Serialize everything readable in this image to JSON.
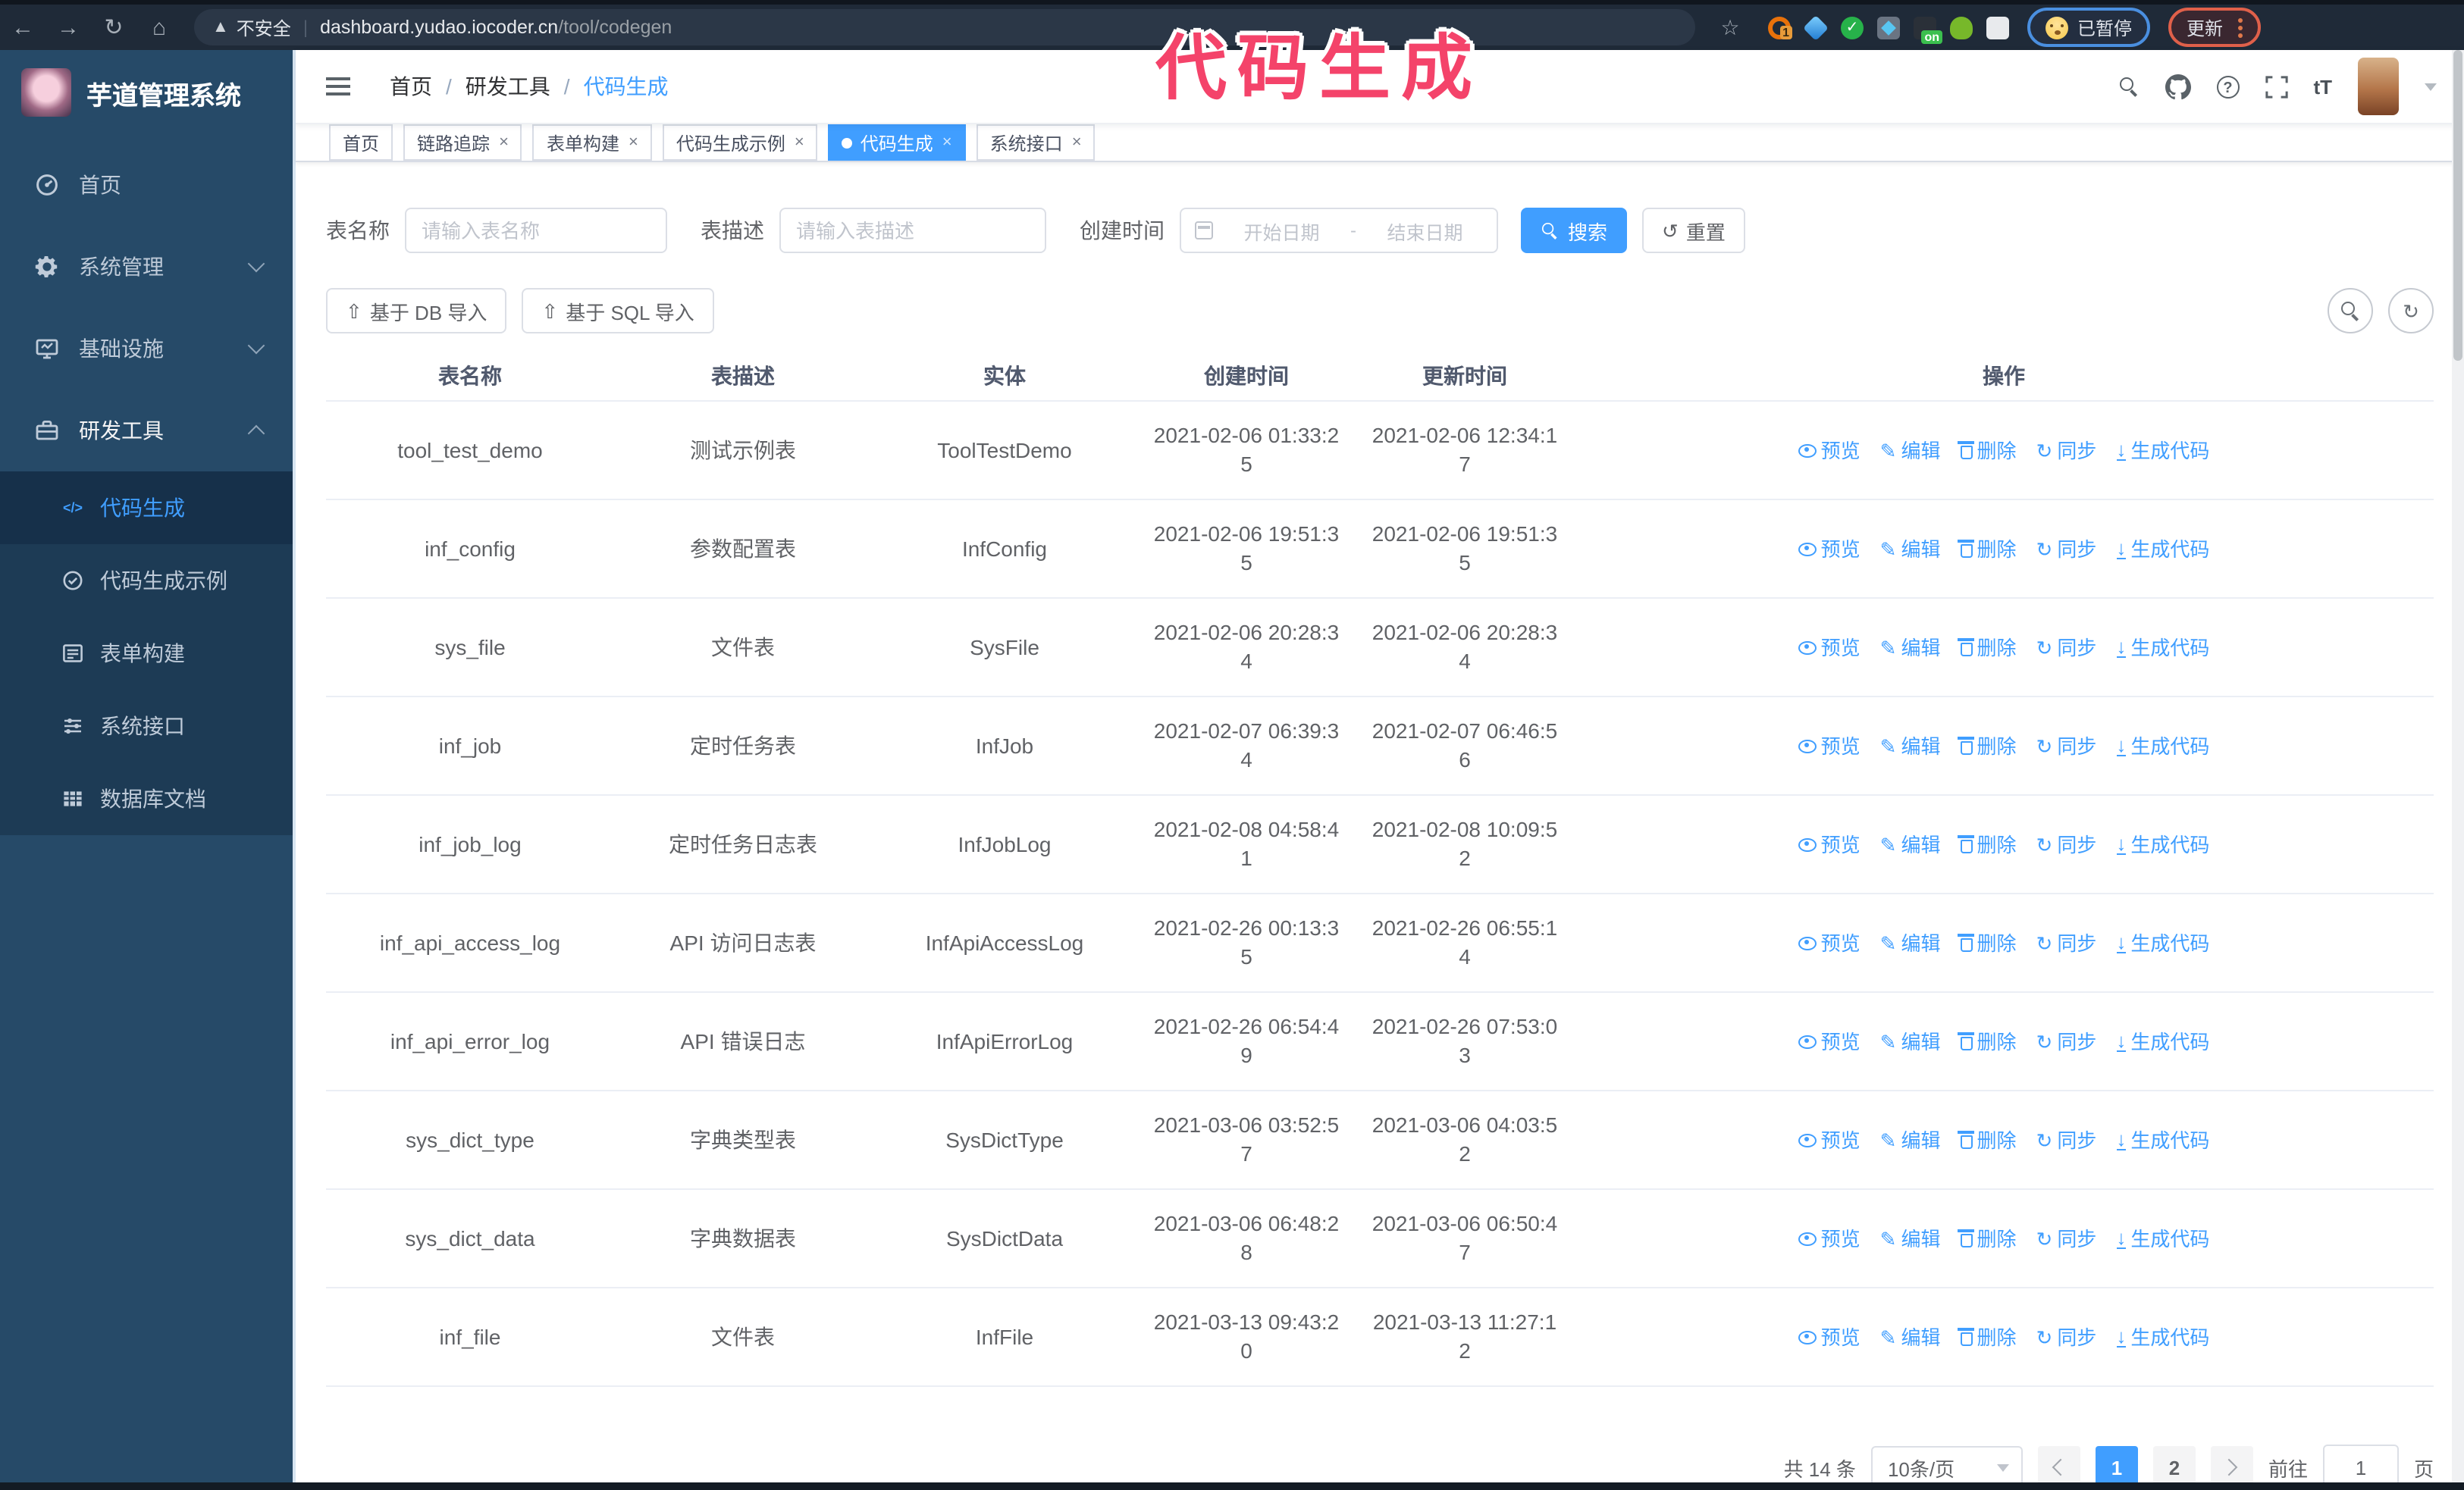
{
  "colors": {
    "accent": "#409eff",
    "annotation": "#f4436a",
    "sidebar_bg": "#264a68",
    "submenu_bg": "#1d3b55",
    "chrome_bg": "#1f2a38"
  },
  "annotation": {
    "text": "代码生成"
  },
  "chrome": {
    "security_label": "不安全",
    "divider": "|",
    "url_host": "dashboard.yudao.iocoder.cn",
    "url_path": "/tool/codegen",
    "extension_badge_1": "1",
    "extension_badge_on": "on",
    "paused_badge": "已暂停",
    "update_button": "更新"
  },
  "sidebar": {
    "title": "芋道管理系统",
    "items": [
      {
        "label": "首页"
      },
      {
        "label": "系统管理"
      },
      {
        "label": "基础设施"
      },
      {
        "label": "研发工具"
      }
    ],
    "subitems": [
      {
        "label": "代码生成"
      },
      {
        "label": "代码生成示例"
      },
      {
        "label": "表单构建"
      },
      {
        "label": "系统接口"
      },
      {
        "label": "数据库文档"
      }
    ]
  },
  "header": {
    "breadcrumb": [
      "首页",
      "研发工具",
      "代码生成"
    ],
    "separator": "/",
    "font_size_icon_text": "tT"
  },
  "tags": [
    {
      "label": "首页"
    },
    {
      "label": "链路追踪"
    },
    {
      "label": "表单构建"
    },
    {
      "label": "代码生成示例"
    },
    {
      "label": "代码生成"
    },
    {
      "label": "系统接口"
    }
  ],
  "search": {
    "name_label": "表名称",
    "name_placeholder": "请输入表名称",
    "desc_label": "表描述",
    "desc_placeholder": "请输入表描述",
    "time_label": "创建时间",
    "start_placeholder": "开始日期",
    "range_separator": "-",
    "end_placeholder": "结束日期",
    "search_button": "搜索",
    "reset_button": "重置"
  },
  "toolbar": {
    "import_db_button": "基于 DB 导入",
    "import_sql_button": "基于 SQL 导入"
  },
  "table": {
    "columns": [
      "表名称",
      "表描述",
      "实体",
      "创建时间",
      "更新时间",
      "操作"
    ],
    "actions": [
      "预览",
      "编辑",
      "删除",
      "同步",
      "生成代码"
    ],
    "rows": [
      {
        "name": "tool_test_demo",
        "desc": "测试示例表",
        "entity": "ToolTestDemo",
        "created": "2021-02-06 01:33:25",
        "updated": "2021-02-06 12:34:17"
      },
      {
        "name": "inf_config",
        "desc": "参数配置表",
        "entity": "InfConfig",
        "created": "2021-02-06 19:51:35",
        "updated": "2021-02-06 19:51:35"
      },
      {
        "name": "sys_file",
        "desc": "文件表",
        "entity": "SysFile",
        "created": "2021-02-06 20:28:34",
        "updated": "2021-02-06 20:28:34"
      },
      {
        "name": "inf_job",
        "desc": "定时任务表",
        "entity": "InfJob",
        "created": "2021-02-07 06:39:34",
        "updated": "2021-02-07 06:46:56"
      },
      {
        "name": "inf_job_log",
        "desc": "定时任务日志表",
        "entity": "InfJobLog",
        "created": "2021-02-08 04:58:41",
        "updated": "2021-02-08 10:09:52"
      },
      {
        "name": "inf_api_access_log",
        "desc": "API 访问日志表",
        "entity": "InfApiAccessLog",
        "created": "2021-02-26 00:13:35",
        "updated": "2021-02-26 06:55:14"
      },
      {
        "name": "inf_api_error_log",
        "desc": "API 错误日志",
        "entity": "InfApiErrorLog",
        "created": "2021-02-26 06:54:49",
        "updated": "2021-02-26 07:53:03"
      },
      {
        "name": "sys_dict_type",
        "desc": "字典类型表",
        "entity": "SysDictType",
        "created": "2021-03-06 03:52:57",
        "updated": "2021-03-06 04:03:52"
      },
      {
        "name": "sys_dict_data",
        "desc": "字典数据表",
        "entity": "SysDictData",
        "created": "2021-03-06 06:48:28",
        "updated": "2021-03-06 06:50:47"
      },
      {
        "name": "inf_file",
        "desc": "文件表",
        "entity": "InfFile",
        "created": "2021-03-13 09:43:20",
        "updated": "2021-03-13 11:27:12"
      }
    ]
  },
  "pagination": {
    "total_text": "共 14 条",
    "page_size": "10条/页",
    "pages": [
      "1",
      "2"
    ],
    "active_page": "1",
    "goto_label": "前往",
    "goto_value": "1",
    "page_suffix": "页"
  }
}
